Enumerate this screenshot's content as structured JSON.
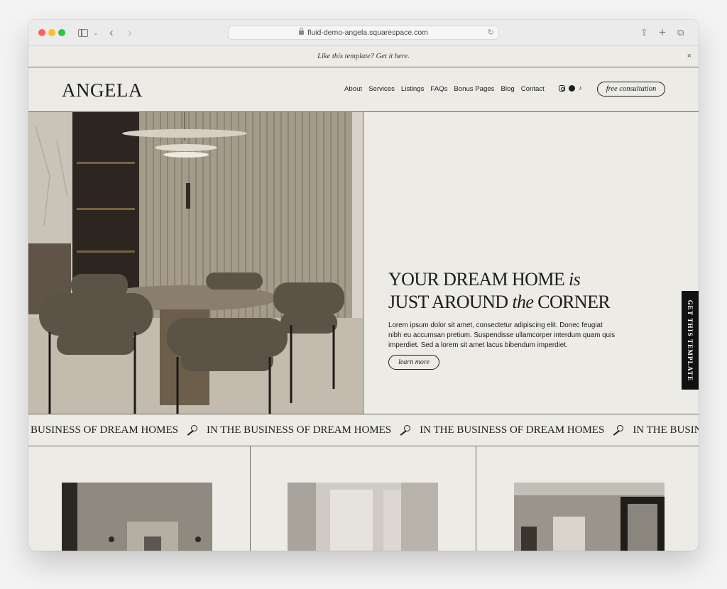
{
  "browser": {
    "url": "fluid-demo-angela.squarespace.com"
  },
  "promo": {
    "text": "Like this template? Get it here.",
    "close": "×"
  },
  "header": {
    "logo": "ANGELA",
    "nav": [
      "About",
      "Services",
      "Listings",
      "FAQs",
      "Bonus Pages",
      "Blog",
      "Contact"
    ],
    "social_icons": [
      "instagram-icon",
      "pinterest-icon",
      "tiktok-icon"
    ],
    "cta": "free consultation"
  },
  "hero": {
    "headline_line1_a": "YOUR DREAM HOME ",
    "headline_line1_b": "is",
    "headline_line2_a": "JUST AROUND ",
    "headline_line2_b": "the",
    "headline_line2_c": " CORNER",
    "body": "Lorem ipsum dolor sit amet, consectetur adipiscing elit. Donec feugiat nibh eu accumsan pretium. Suspendisse ullamcorper interdum quam quis imperdiet. Sed a lorem sit amet lacus bibendum imperdiet.",
    "button": "learn more"
  },
  "side_tab": "GET THIS TEMPLATE",
  "marquee": {
    "first": "BUSINESS OF DREAM HOMES",
    "repeat": "IN THE BUSINESS OF DREAM HOMES",
    "last": "IN THE BUSINESS OF DREAM HOMI"
  },
  "colors": {
    "background": "#edebe6",
    "text": "#1c1c1c",
    "rule": "#6d6b66"
  }
}
